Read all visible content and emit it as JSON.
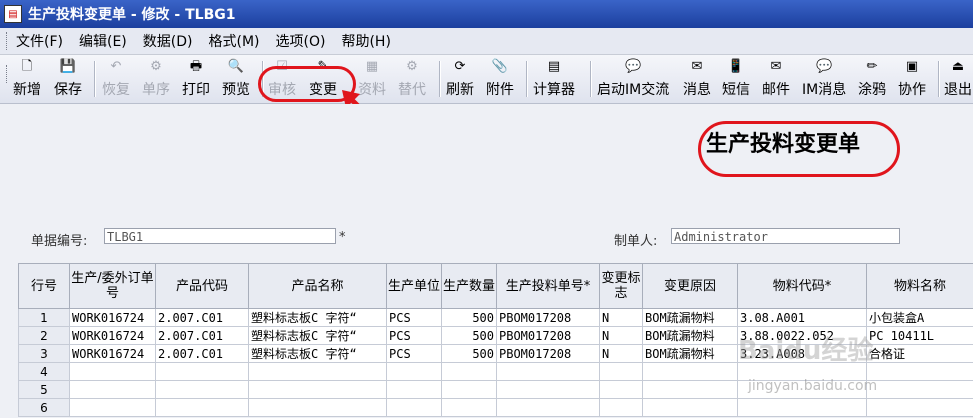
{
  "window": {
    "title": "生产投料变更单 - 修改 - TLBG1"
  },
  "menu": [
    {
      "label": "文件(F)"
    },
    {
      "label": "编辑(E)"
    },
    {
      "label": "数据(D)"
    },
    {
      "label": "格式(M)"
    },
    {
      "label": "选项(O)"
    },
    {
      "label": "帮助(H)"
    }
  ],
  "toolbar": [
    {
      "label": "新增",
      "icon": "new-doc-icon",
      "glyph": "🗋",
      "enabled": true
    },
    {
      "label": "保存",
      "icon": "save-icon",
      "glyph": "💾",
      "enabled": true
    },
    {
      "label": "恢复",
      "icon": "undo-icon",
      "glyph": "↶",
      "enabled": false
    },
    {
      "label": "单序",
      "icon": "sort-icon",
      "glyph": "⚙",
      "enabled": false
    },
    {
      "label": "打印",
      "icon": "print-icon",
      "glyph": "🖶",
      "enabled": true
    },
    {
      "label": "预览",
      "icon": "preview-icon",
      "glyph": "🔍",
      "enabled": true
    },
    {
      "label": "审核",
      "icon": "approve-icon",
      "glyph": "☑",
      "enabled": false
    },
    {
      "label": "变更",
      "icon": "change-icon",
      "glyph": "✎",
      "enabled": true
    },
    {
      "label": "资料",
      "icon": "data-icon",
      "glyph": "▦",
      "enabled": false
    },
    {
      "label": "替代",
      "icon": "replace-icon",
      "glyph": "⚙",
      "enabled": false
    },
    {
      "label": "刷新",
      "icon": "refresh-icon",
      "glyph": "⟳",
      "enabled": true
    },
    {
      "label": "附件",
      "icon": "attachment-icon",
      "glyph": "📎",
      "enabled": true
    },
    {
      "label": "计算器",
      "icon": "calculator-icon",
      "glyph": "▤",
      "enabled": true
    },
    {
      "label": "启动IM交流",
      "icon": "im-chat-icon",
      "glyph": "💬",
      "enabled": true
    },
    {
      "label": "消息",
      "icon": "message-icon",
      "glyph": "✉",
      "enabled": true
    },
    {
      "label": "短信",
      "icon": "sms-icon",
      "glyph": "📱",
      "enabled": true
    },
    {
      "label": "邮件",
      "icon": "mail-icon",
      "glyph": "✉",
      "enabled": true
    },
    {
      "label": "IM消息",
      "icon": "im-message-icon",
      "glyph": "💬",
      "enabled": true
    },
    {
      "label": "涂鸦",
      "icon": "doodle-icon",
      "glyph": "✏",
      "enabled": true
    },
    {
      "label": "协作",
      "icon": "collaborate-icon",
      "glyph": "▣",
      "enabled": true
    },
    {
      "label": "退出",
      "icon": "exit-icon",
      "glyph": "⏏",
      "enabled": true
    }
  ],
  "document": {
    "heading": "生产投料变更单",
    "doc_no_label": "单据编号:",
    "doc_no_value": "TLBG1",
    "required_mark": "*",
    "creator_label": "制单人:",
    "creator_value": "Administrator"
  },
  "grid": {
    "columns": [
      "行号",
      "生产/委外订单号",
      "产品代码",
      "产品名称",
      "生产单位",
      "生产数量",
      "生产投料单号*",
      "变更标志",
      "变更原因",
      "物料代码*",
      "物料名称"
    ],
    "rows": [
      [
        "1",
        "WORK016724",
        "2.007.C01",
        "塑料标志板C 字符“",
        "PCS",
        "500",
        "PBOM017208",
        "N",
        "BOM疏漏物料",
        "3.08.A001",
        "小包装盒A"
      ],
      [
        "2",
        "WORK016724",
        "2.007.C01",
        "塑料标志板C 字符“",
        "PCS",
        "500",
        "PBOM017208",
        "N",
        "BOM疏漏物料",
        "3.88.0022.052",
        "PC 10411L"
      ],
      [
        "3",
        "WORK016724",
        "2.007.C01",
        "塑料标志板C 字符“",
        "PCS",
        "500",
        "PBOM017208",
        "N",
        "BOM疏漏物料",
        "3.23.A008",
        "合格证"
      ],
      [
        "4",
        "",
        "",
        "",
        "",
        "",
        "",
        "",
        "",
        "",
        ""
      ],
      [
        "5",
        "",
        "",
        "",
        "",
        "",
        "",
        "",
        "",
        "",
        ""
      ],
      [
        "6",
        "",
        "",
        "",
        "",
        "",
        "",
        "",
        "",
        "",
        ""
      ]
    ]
  },
  "watermark": {
    "text": "Baidu经验",
    "url_text": "jingyan.baidu.com"
  }
}
